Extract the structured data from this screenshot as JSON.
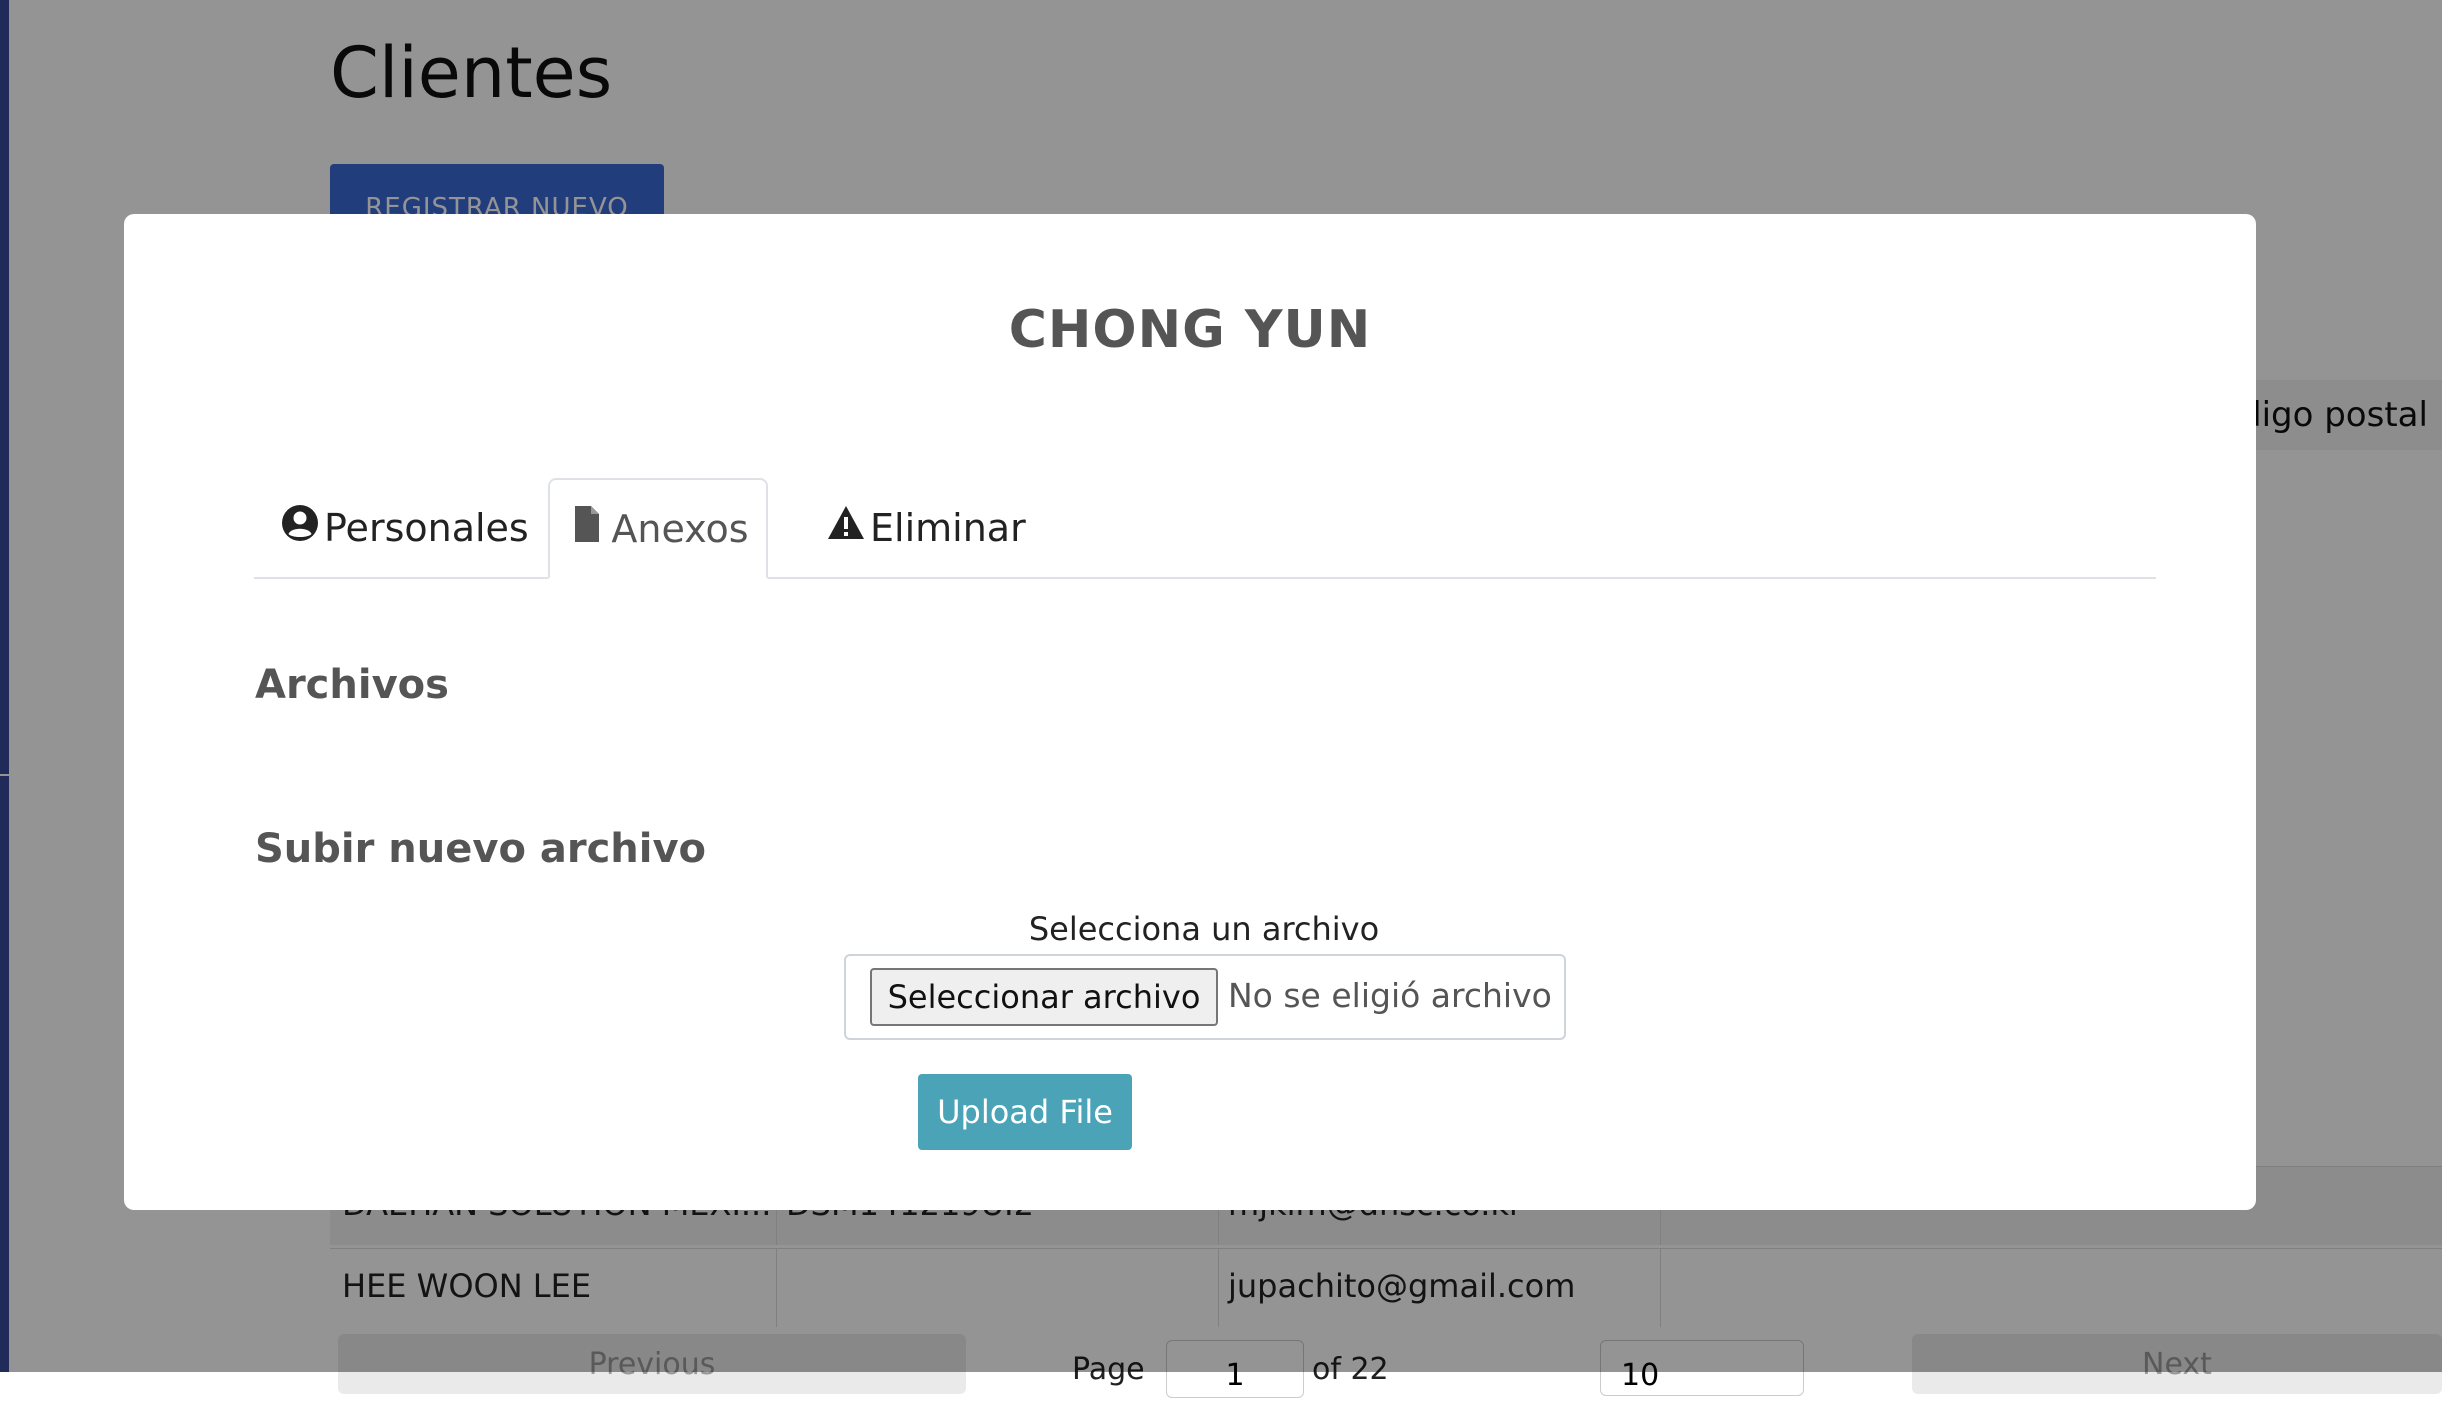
{
  "page": {
    "title": "Clientes",
    "register_button": "REGISTRAR NUEVO"
  },
  "table": {
    "visible_header": "digo postal",
    "rows": [
      {
        "name": "DAEHAN SOLUTION MEXI...",
        "code": "DSM141219UI2",
        "email": "mjkim@dhsc.co.kr"
      },
      {
        "name": "HEE WOON LEE",
        "code": "",
        "email": "jupachito@gmail.com"
      }
    ],
    "pagination": {
      "previous_label": "Previous",
      "page_label": "Page",
      "page_value": "1",
      "of_label": "of 22",
      "rows_select": "10",
      "next_label": "Next"
    }
  },
  "modal": {
    "title": "CHONG YUN",
    "tabs": [
      {
        "label": "Personales",
        "icon": "user-circle-icon",
        "active": false
      },
      {
        "label": "Anexos",
        "icon": "file-icon",
        "active": true
      },
      {
        "label": "Eliminar",
        "icon": "warning-icon",
        "active": false
      }
    ],
    "archivos_heading": "Archivos",
    "upload_heading": "Subir nuevo archivo",
    "file_label": "Selecciona un archivo",
    "file_button": "Seleccionar archivo",
    "file_status": "No se eligió archivo",
    "upload_button": "Upload File"
  },
  "colors": {
    "register_button": "#3c6ad4",
    "upload_button": "#4ba3b8",
    "sidebar": "#3a4a9a"
  }
}
